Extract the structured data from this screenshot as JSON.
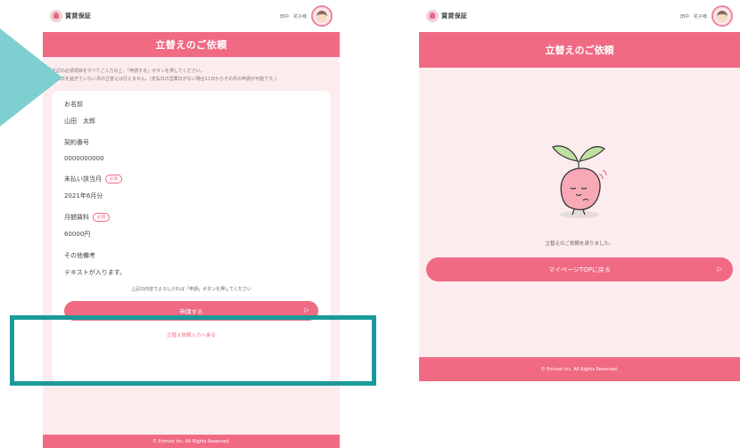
{
  "brand": {
    "logo_text": "賃貸保証"
  },
  "user": {
    "name": "田中　花子様"
  },
  "form_screen": {
    "title": "立替えのご依頼",
    "notice_line1": "下記の必須項目をすべてご入力の上、「申請する」ボタンを押してください。",
    "notice_line2": "支払日を過ぎていない月の立替えは行えません。(支払日の営業日がない場合11日からその月の申請が可能です。)",
    "fields": [
      {
        "label": "お名前",
        "value": "山田　太郎",
        "required": false
      },
      {
        "label": "契約番号",
        "value": "0000000000",
        "required": false
      },
      {
        "label": "未払い該当月",
        "value": "2021年6月分",
        "required": true
      },
      {
        "label": "月額賃料",
        "value": "60000円",
        "required": true
      },
      {
        "label": "その他備考",
        "value": "テキストが入ります。",
        "required": false
      }
    ],
    "required_badge": "必須",
    "confirm_text": "上記の内容でよろしければ「申請」ボタンを押してください",
    "submit_label": "申請する",
    "back_link": "立替え依頼入力へ戻る",
    "footer": "© Entrust Inc. All Rights Reserved."
  },
  "done_screen": {
    "title": "立替えのご依頼",
    "message": "立替えのご依頼を承りました。",
    "button_label": "マイページTOPに戻る",
    "footer": "© Entrust Inc. All Rights Reserved."
  },
  "colors": {
    "accent": "#f06a84",
    "background_pink": "#fdecee",
    "teal_frame": "#1a9a9a",
    "teal_arrow": "#7ecfcf"
  },
  "icons": {
    "arrow": "chevron-right-icon",
    "mascot": "sprout-mascot-icon"
  }
}
